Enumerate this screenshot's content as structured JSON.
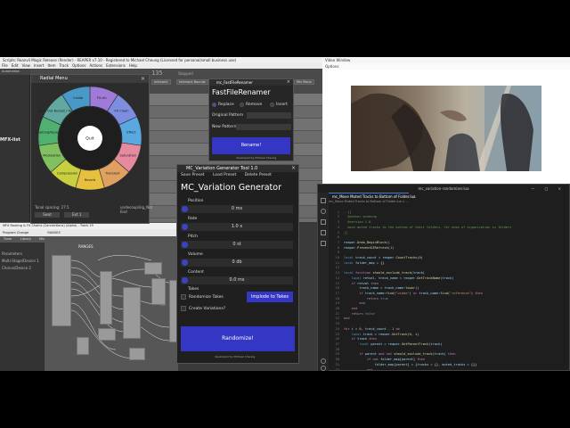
{
  "reaper": {
    "title": "Scripts: Reanvil Magic Release (Render) - REAPER v7.10 - Registered to Michael Cheung (Licensed for personal/small business use)",
    "menu": [
      "File",
      "Edit",
      "View",
      "Insert",
      "Item",
      "Track",
      "Options",
      "Actions",
      "Extensions",
      "Help"
    ],
    "time": "135",
    "time_label": "Stopped",
    "toolbar": [
      "Intersect",
      "Intersect Bounds",
      "Mic Stereo",
      "Mix Mono"
    ],
    "side_labels": [
      "Automation",
      "MFX-list"
    ]
  },
  "radial": {
    "title": "Radial Menu",
    "close": "×",
    "center": "Quit",
    "segments": [
      "FX.ish",
      "FX Chain",
      "Effect",
      "Saturation",
      "Transient",
      "Reverb",
      "Compression",
      "Modulation",
      "Dubbing/Reverb",
      "Send Out Bucket / Tempo",
      "Inside"
    ],
    "footer_left": "Tonal spacing: 27.5",
    "footer_right": "undecoupling_Not End",
    "btn_a": "Swat",
    "btn_b": "Ext 1"
  },
  "routing": {
    "title": "MFX Routing & FX Chains (Connections) (Alpha) - Track 19",
    "bar_left": "Program Change",
    "bar_mid": "RANGES",
    "tabs": [
      "Tuner",
      "Library",
      "Mix"
    ],
    "side_labels": [
      "Parameters",
      "Multi-Stage/Device 1",
      "Chorus/Device 2"
    ],
    "canvas_label": "RANGES"
  },
  "ffr": {
    "title": "mc_FastFileRenamer",
    "close": "×",
    "heading": "FastFileRenamer",
    "modes": [
      "Replace",
      "Remove",
      "Insert"
    ],
    "original_label": "Original Pattern",
    "new_label": "New Pattern:",
    "rename_btn": "Rename!",
    "dev": "developed by Michael Cheung"
  },
  "mcv": {
    "title": "MC_Variation Generator Tool 1.0",
    "close": "×",
    "menu": [
      "Save Preset",
      "Load Preset",
      "Delete Preset"
    ],
    "heading": "MC_Variation Generator",
    "position_label": "Position",
    "position_val": "0 ms",
    "rate_label": "Rate",
    "rate_val": "1.0 x",
    "pitch_label": "Pitch",
    "pitch_val": "0 st",
    "volume_label": "Volume",
    "volume_val": "0 db",
    "content_label": "Content",
    "content_val": "0.0 ms",
    "takes_label": "Takes",
    "randomize_takes": "Randomize Takes",
    "implode_btn": "Implode to Takes",
    "create_variations": "Create Variations?",
    "randomize_btn": "Randomize!",
    "dev": "developed by Michael Cheung"
  },
  "video": {
    "title": "Video Window",
    "options": "Options"
  },
  "vscode": {
    "title": "mc_variation-randomizer.lua",
    "tab": "mc_Move Muted Tracks to Bottom of Folder.lua",
    "breadcrumb": "mc_Move Muted Tracks to Bottom of Folder.lua > ...",
    "window_controls": "— □ ×"
  }
}
